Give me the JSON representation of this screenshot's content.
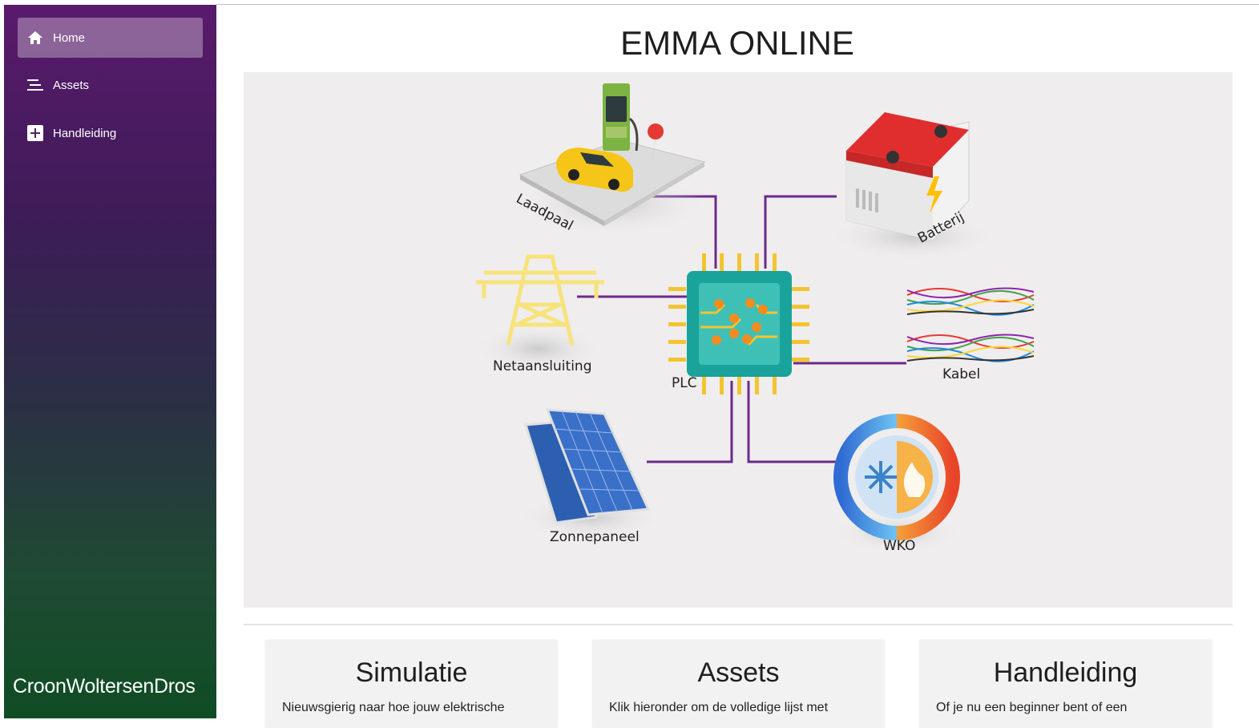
{
  "sidebar": {
    "items": [
      {
        "label": "Home",
        "icon": "home-icon",
        "active": true
      },
      {
        "label": "Assets",
        "icon": "list-icon",
        "active": false
      },
      {
        "label": "Handleiding",
        "icon": "plus-icon",
        "active": false
      }
    ],
    "brand": "CroonWoltersenDros"
  },
  "main": {
    "title": "EMMA ONLINE",
    "diagram": {
      "labels": {
        "laadpaal": "Laadpaal",
        "batterij": "Batterij",
        "netaansluiting": "Netaansluiting",
        "plc": "PLC",
        "kabel": "Kabel",
        "zonnepaneel": "Zonnepaneel",
        "wko": "WKO"
      }
    },
    "cards": [
      {
        "title": "Simulatie",
        "text": "Nieuwsgierig naar hoe jouw elektrische"
      },
      {
        "title": "Assets",
        "text": "Klik hieronder om de volledige lijst met"
      },
      {
        "title": "Handleiding",
        "text": "Of je nu een beginner bent of een"
      }
    ]
  },
  "colors": {
    "sidebar_top": "#5a1a6c",
    "sidebar_bottom": "#0f4d24",
    "connector": "#6b2a8a",
    "chip": "#1aa39a"
  }
}
